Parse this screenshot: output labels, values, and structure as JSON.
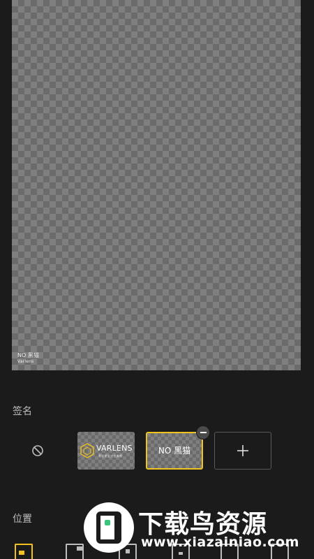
{
  "canvas": {
    "signature_text": "NO 黑猫",
    "signature_sub": "Varlens"
  },
  "signature_section": {
    "label": "签名",
    "none_option_icon": "no-sign-icon",
    "options": [
      {
        "name": "VARLENS",
        "sub": "莱伦斯全方位美颜",
        "icon": "hexagon-logo-icon",
        "selected": false
      },
      {
        "name": "NO 黑猫",
        "selected": true
      }
    ],
    "remove_icon": "minus-icon",
    "add_icon": "plus-icon"
  },
  "position_section": {
    "label": "位置",
    "options": [
      {
        "icon": "position-bottom-left-icon",
        "selected": true
      },
      {
        "icon": "position-bottom-right-icon",
        "selected": false
      },
      {
        "icon": "position-bottom-center-icon",
        "selected": false
      },
      {
        "icon": "position-center-icon",
        "selected": false
      },
      {
        "icon": "position-top-icon",
        "selected": false
      },
      {
        "icon": "position-top-right-icon",
        "selected": false
      }
    ]
  },
  "watermark": {
    "title": "下载鸟资源",
    "url": "www.xiazainiao.com"
  },
  "colors": {
    "background": "#1b1b1b",
    "accent": "#f2c21d",
    "checker_light": "#7f7f7f",
    "checker_dark": "#6b6b6b"
  }
}
